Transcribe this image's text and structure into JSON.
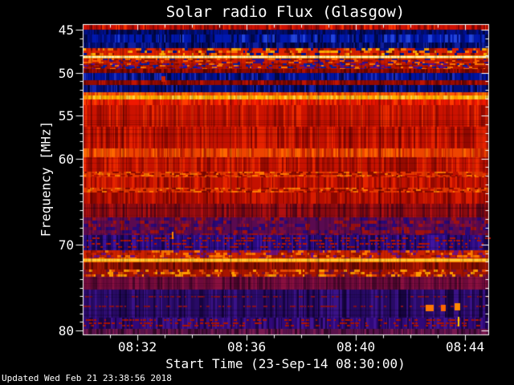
{
  "updated": "Updated Wed Feb 21 23:38:56 2018",
  "colors": {
    "background": "#000000",
    "foreground": "#ffffff",
    "bright_line": "#ffffcc",
    "strong_emission": "#cc1100",
    "quiet_band": "#000d80"
  },
  "chart_data": {
    "type": "heatmap",
    "title": "Solar radio Flux (Glasgow)",
    "xlabel": "Start Time (23-Sep-14 08:30:00)",
    "ylabel": "Frequency [MHz]",
    "x_axis": {
      "label": "Start Time (23-Sep-14 08:30:00)",
      "start_time": "08:30:00",
      "date": "23-Sep-14",
      "end_minutes": 14.85,
      "minor_step_minutes": 1,
      "major_ticks": [
        {
          "t": 2,
          "label": "08:32"
        },
        {
          "t": 6,
          "label": "08:36"
        },
        {
          "t": 10,
          "label": "08:40"
        },
        {
          "t": 14,
          "label": "08:44"
        }
      ]
    },
    "y_axis": {
      "label": "Frequency [MHz]",
      "min": 44.35,
      "max": 80.45,
      "labeled_ticks": [
        45,
        50,
        55,
        60,
        70,
        80
      ],
      "minor_step": 1
    },
    "legend": "none",
    "grid": "off",
    "bands": [
      {
        "f0": 44.35,
        "f1": 45.02,
        "style": "stripes",
        "colors": [
          "#d01000",
          "#8a0500",
          "#ff3300",
          "#b00c00"
        ]
      },
      {
        "f0": 45.02,
        "f1": 45.58,
        "style": "stripes",
        "colors": [
          "#000d66",
          "#001090",
          "#000540"
        ]
      },
      {
        "f0": 45.58,
        "f1": 46.52,
        "style": "stripes",
        "colors": [
          "#0018b0",
          "#00084a",
          "#2244dd",
          "#000d80"
        ]
      },
      {
        "f0": 46.52,
        "f1": 47.18,
        "style": "stripes",
        "colors": [
          "#000d70",
          "#000438",
          "#1020a0"
        ]
      },
      {
        "f0": 47.18,
        "f1": 47.95,
        "style": "patchy",
        "colors": [
          "#dd2200",
          "#ff7700",
          "#001090",
          "#ffaa00",
          "#8a1000"
        ]
      },
      {
        "f0": 47.95,
        "f1": 48.32,
        "style": "hline",
        "colors": [
          "#ff9900",
          "#ffffcc",
          "#ffee66"
        ]
      },
      {
        "f0": 48.32,
        "f1": 48.88,
        "style": "patchy",
        "colors": [
          "#cc1c00",
          "#ff6600",
          "#991100",
          "#30108a"
        ]
      },
      {
        "f0": 48.88,
        "f1": 49.62,
        "style": "patchy",
        "colors": [
          "#b81400",
          "#0020a8",
          "#ff7700",
          "#5a0d8a",
          "#8a0a00"
        ]
      },
      {
        "f0": 49.62,
        "f1": 50.08,
        "style": "stripes",
        "colors": [
          "#8a0700",
          "#600400",
          "#b01000"
        ]
      },
      {
        "f0": 50.08,
        "f1": 50.92,
        "style": "stripes",
        "colors": [
          "#0012a0",
          "#000848",
          "#2030c0",
          "#000d70"
        ]
      },
      {
        "f0": 50.92,
        "f1": 51.48,
        "style": "stripes",
        "colors": [
          "#960a00",
          "#6a0500",
          "#c01400"
        ]
      },
      {
        "f0": 51.48,
        "f1": 52.32,
        "style": "stripes",
        "colors": [
          "#000d7a",
          "#000440",
          "#1525b0"
        ]
      },
      {
        "f0": 52.32,
        "f1": 52.68,
        "style": "stripes",
        "colors": [
          "#ff5500",
          "#dd3300",
          "#ff7700"
        ]
      },
      {
        "f0": 52.68,
        "f1": 53.15,
        "style": "stripes",
        "colors": [
          "#ffb400",
          "#ff9000",
          "#ffd040"
        ]
      },
      {
        "f0": 53.15,
        "f1": 53.8,
        "style": "stripes",
        "colors": [
          "#f01800",
          "#c81000",
          "#ff3c00"
        ]
      },
      {
        "f0": 53.8,
        "f1": 56.3,
        "style": "stripes",
        "colors": [
          "#cc1200",
          "#9a0a00",
          "#ee2a00",
          "#b81000"
        ]
      },
      {
        "f0": 56.3,
        "f1": 58.85,
        "style": "stripes",
        "colors": [
          "#c21000",
          "#940800",
          "#e62200"
        ]
      },
      {
        "f0": 58.85,
        "f1": 59.8,
        "style": "stripes",
        "colors": [
          "#ee4400",
          "#cc2200",
          "#ff6600"
        ]
      },
      {
        "f0": 59.8,
        "f1": 61.55,
        "style": "stripes",
        "colors": [
          "#c81200",
          "#980a00",
          "#ea2800"
        ]
      },
      {
        "f0": 61.55,
        "f1": 62.15,
        "style": "patchy",
        "colors": [
          "#e63800",
          "#ff7700",
          "#8a0a00",
          "#c01000"
        ]
      },
      {
        "f0": 62.15,
        "f1": 63.35,
        "style": "stripes",
        "colors": [
          "#c41100",
          "#940800",
          "#e62400"
        ]
      },
      {
        "f0": 63.35,
        "f1": 63.95,
        "style": "patchy",
        "colors": [
          "#e63800",
          "#ff7700",
          "#8a0a00",
          "#c01000"
        ]
      },
      {
        "f0": 63.95,
        "f1": 65.25,
        "style": "stripes",
        "colors": [
          "#b80e00",
          "#8a0700",
          "#d81c00"
        ]
      },
      {
        "f0": 65.25,
        "f1": 66.8,
        "style": "stripes",
        "colors": [
          "#8a0a10",
          "#5a0618",
          "#b01010"
        ]
      },
      {
        "f0": 66.8,
        "f1": 68.85,
        "style": "patchy",
        "colors": [
          "#5a0a50",
          "#a01010",
          "#2a0878",
          "#780d40"
        ]
      },
      {
        "f0": 68.85,
        "f1": 70.7,
        "style": "speckle",
        "colors": [
          "#2a0a80",
          "#180550",
          "#4015a0"
        ],
        "dot": "#b81400",
        "rows": 4
      },
      {
        "f0": 70.7,
        "f1": 71.62,
        "style": "patchy",
        "colors": [
          "#cc2200",
          "#ff7700",
          "#70107a",
          "#a01400"
        ]
      },
      {
        "f0": 71.62,
        "f1": 72.08,
        "style": "hline",
        "colors": [
          "#ff8800",
          "#ffd040",
          "#ffb420"
        ]
      },
      {
        "f0": 72.08,
        "f1": 72.85,
        "style": "stripes",
        "colors": [
          "#8c1000",
          "#640a00",
          "#b01800"
        ]
      },
      {
        "f0": 72.85,
        "f1": 73.78,
        "style": "patchy",
        "colors": [
          "#a81400",
          "#e64a00",
          "#ff9900",
          "#781030"
        ]
      },
      {
        "f0": 73.78,
        "f1": 75.18,
        "style": "stripes",
        "colors": [
          "#6e0a3c",
          "#48062a",
          "#8a1040"
        ]
      },
      {
        "f0": 75.18,
        "f1": 78.45,
        "style": "speckle",
        "colors": [
          "#280a66",
          "#160440",
          "#3a1288"
        ],
        "dot": "#8a1020",
        "rows": 2
      },
      {
        "f0": 78.45,
        "f1": 79.82,
        "style": "speckle",
        "colors": [
          "#30087a",
          "#1c054a",
          "#421495"
        ],
        "dot": "#b01400",
        "rows": 3
      },
      {
        "f0": 79.82,
        "f1": 80.45,
        "style": "stripes",
        "colors": [
          "#58104a",
          "#330828",
          "#7a1850"
        ]
      }
    ],
    "features": [
      {
        "type": "blob",
        "t": 12.7,
        "f": 77.35,
        "w": 10,
        "h": 8,
        "color": "#ff7700"
      },
      {
        "type": "blob",
        "t": 13.2,
        "f": 77.35,
        "w": 6,
        "h": 8,
        "color": "#ff6600"
      },
      {
        "type": "blob",
        "t": 13.72,
        "f": 77.25,
        "w": 7,
        "h": 9,
        "color": "#ff8800"
      },
      {
        "type": "vdash",
        "t": 13.75,
        "f0": 78.4,
        "f1": 79.5,
        "color": "#ffcc00"
      },
      {
        "type": "vdash",
        "t": 3.3,
        "f0": 68.5,
        "f1": 69.3,
        "color": "#ff8800"
      },
      {
        "type": "blob",
        "t": 2.95,
        "f": 50.7,
        "w": 5,
        "h": 7,
        "color": "#cc2200"
      }
    ]
  }
}
